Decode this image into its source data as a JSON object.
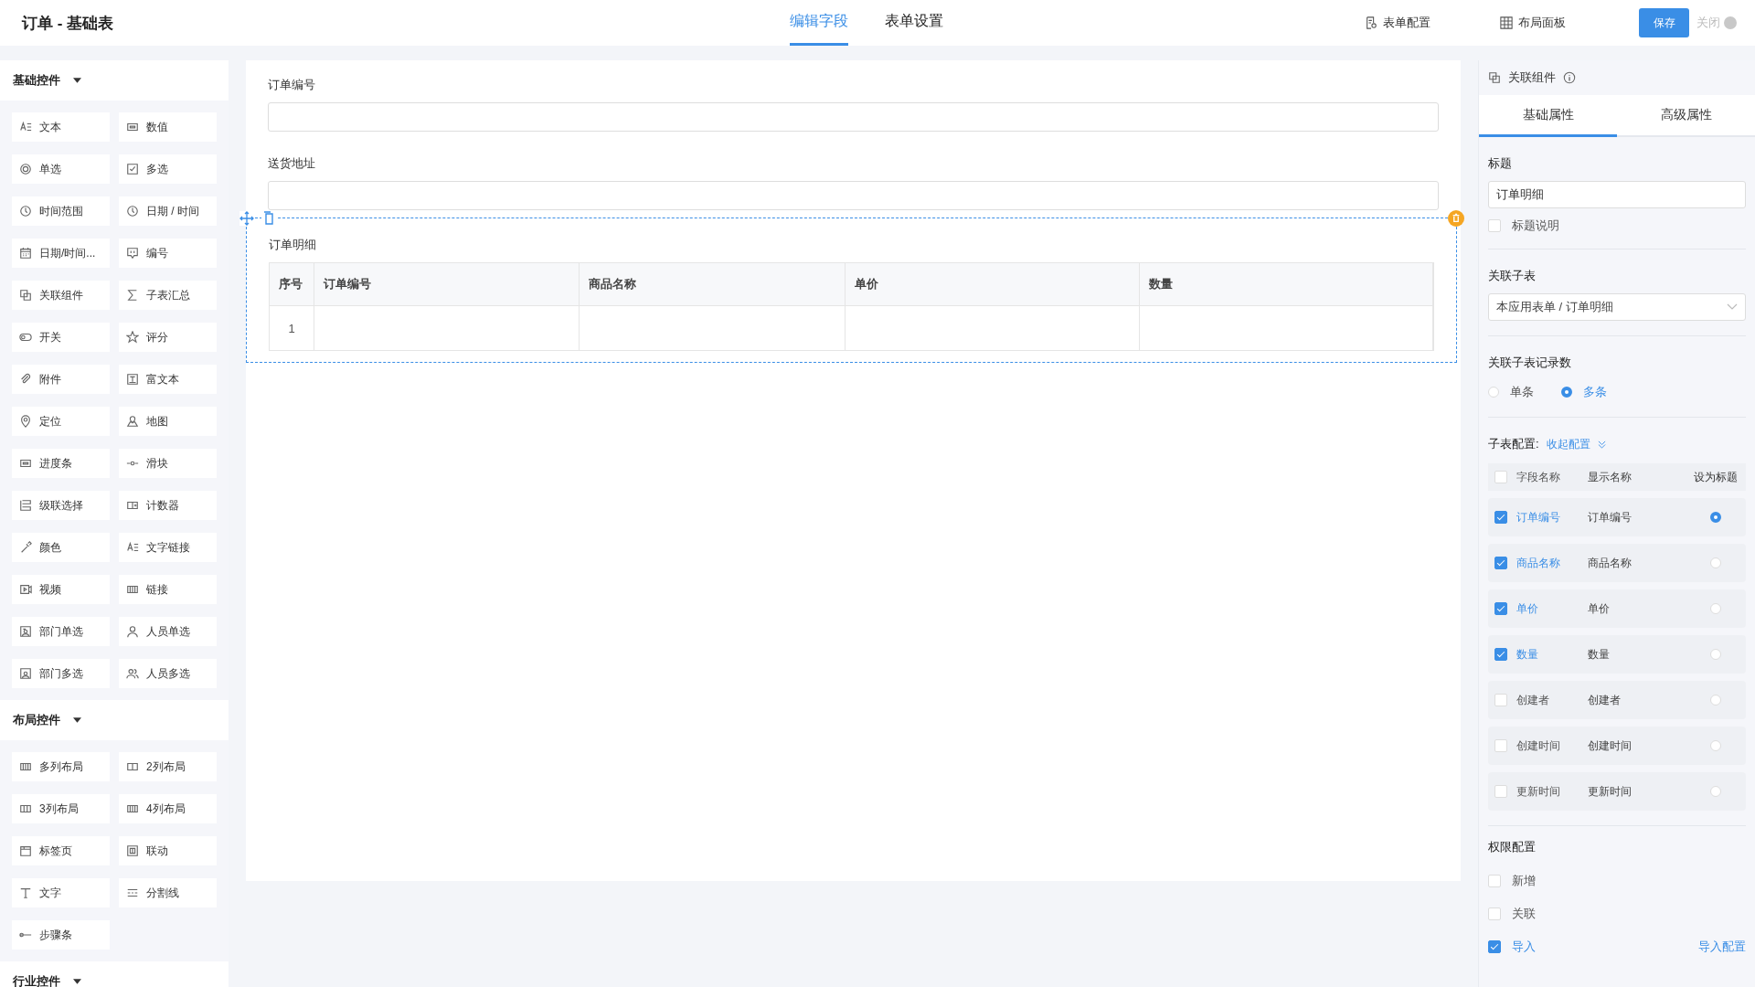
{
  "header": {
    "title": "订单 - 基础表",
    "tabs": [
      {
        "label": "编辑字段",
        "selected": true
      },
      {
        "label": "表单设置",
        "selected": false
      }
    ],
    "actions": [
      {
        "label": "表单配置"
      },
      {
        "label": "布局面板"
      }
    ],
    "save": "保存",
    "close": "关闭"
  },
  "sidebar": {
    "groups": [
      {
        "title": "基础控件",
        "items": [
          {
            "label": "文本"
          },
          {
            "label": "数值"
          },
          {
            "label": "单选"
          },
          {
            "label": "多选"
          },
          {
            "label": "时间范围"
          },
          {
            "label": "日期 / 时间"
          },
          {
            "label": "日期/时间..."
          },
          {
            "label": "编号"
          },
          {
            "label": "关联组件"
          },
          {
            "label": "子表汇总"
          },
          {
            "label": "开关"
          },
          {
            "label": "评分"
          },
          {
            "label": "附件"
          },
          {
            "label": "富文本"
          },
          {
            "label": "定位"
          },
          {
            "label": "地图"
          },
          {
            "label": "进度条"
          },
          {
            "label": "滑块"
          },
          {
            "label": "级联选择"
          },
          {
            "label": "计数器"
          },
          {
            "label": "颜色"
          },
          {
            "label": "文字链接"
          },
          {
            "label": "视频"
          },
          {
            "label": "链接"
          },
          {
            "label": "部门单选"
          },
          {
            "label": "人员单选"
          },
          {
            "label": "部门多选"
          },
          {
            "label": "人员多选"
          }
        ]
      },
      {
        "title": "布局控件",
        "items": [
          {
            "label": "多列布局"
          },
          {
            "label": "2列布局"
          },
          {
            "label": "3列布局"
          },
          {
            "label": "4列布局"
          },
          {
            "label": "标签页"
          },
          {
            "label": "联动"
          },
          {
            "label": "文字"
          },
          {
            "label": "分割线"
          },
          {
            "label": "步骤条"
          }
        ]
      },
      {
        "title": "行业控件"
      }
    ]
  },
  "canvas": {
    "fields": [
      {
        "label": "订单编号"
      },
      {
        "label": "送货地址"
      }
    ],
    "subtable": {
      "title": "订单明细",
      "columns": [
        "序号",
        "订单编号",
        "商品名称",
        "单价",
        "数量"
      ],
      "rows": [
        {
          "index": "1"
        }
      ]
    }
  },
  "properties": {
    "component": "关联组件",
    "tabs": [
      {
        "label": "基础属性",
        "selected": true
      },
      {
        "label": "高级属性",
        "selected": false
      }
    ],
    "title_label": "标题",
    "title_value": "订单明细",
    "title_note": {
      "label": "标题说明",
      "checked": false
    },
    "linked_label": "关联子表",
    "linked_value": "本应用表单 / 订单明细",
    "count_label": "关联子表记录数",
    "count_options": [
      {
        "label": "单条",
        "selected": false
      },
      {
        "label": "多条",
        "selected": true
      }
    ],
    "config_label": "子表配置:",
    "config_toggle": "收起配置",
    "config_columns": [
      "字段名称",
      "显示名称",
      "设为标题"
    ],
    "config_all_checked": false,
    "config_fields": [
      {
        "name": "订单编号",
        "display": "订单编号",
        "checked": true,
        "selected": true
      },
      {
        "name": "商品名称",
        "display": "商品名称",
        "checked": true,
        "selected": false
      },
      {
        "name": "单价",
        "display": "单价",
        "checked": true,
        "selected": false
      },
      {
        "name": "数量",
        "display": "数量",
        "checked": true,
        "selected": false
      },
      {
        "name": "创建者",
        "display": "创建者",
        "checked": false,
        "selected": false
      },
      {
        "name": "创建时间",
        "display": "创建时间",
        "checked": false,
        "selected": false
      },
      {
        "name": "更新时间",
        "display": "更新时间",
        "checked": false,
        "selected": false
      }
    ],
    "permissions_label": "权限配置",
    "permissions": [
      {
        "label": "新增",
        "checked": false
      },
      {
        "label": "关联",
        "checked": false
      },
      {
        "label": "导入",
        "checked": true
      }
    ],
    "import_link": "导入配置"
  }
}
